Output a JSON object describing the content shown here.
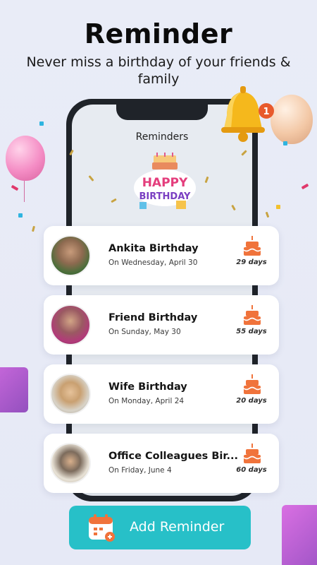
{
  "header": {
    "title": "Reminder",
    "subtitle": "Never miss a birthday of your friends & family"
  },
  "phone": {
    "screen_title": "Reminders",
    "badge_line1": "HAPPY",
    "badge_line2": "BIRTHDAY"
  },
  "bell": {
    "count": "1"
  },
  "reminders": [
    {
      "name": "Ankita Birthday",
      "date": "On Wednesday, April 30",
      "days": "29 days"
    },
    {
      "name": "Friend Birthday",
      "date": "On Sunday, May 30",
      "days": "55 days"
    },
    {
      "name": "Wife Birthday",
      "date": "On Monday, April 24",
      "days": "20 days"
    },
    {
      "name": "Office Colleagues Bir...",
      "date": "On Friday, June 4",
      "days": "60 days"
    }
  ],
  "add_button": {
    "label": "Add Reminder"
  },
  "colors": {
    "accent": "#27c0c8",
    "cake": "#f0733b",
    "background": "#e9ecf7",
    "phone_frame": "#1f2329"
  },
  "icons": [
    "bell-icon",
    "cake-icon",
    "calendar-icon",
    "balloon",
    "gift-box"
  ]
}
